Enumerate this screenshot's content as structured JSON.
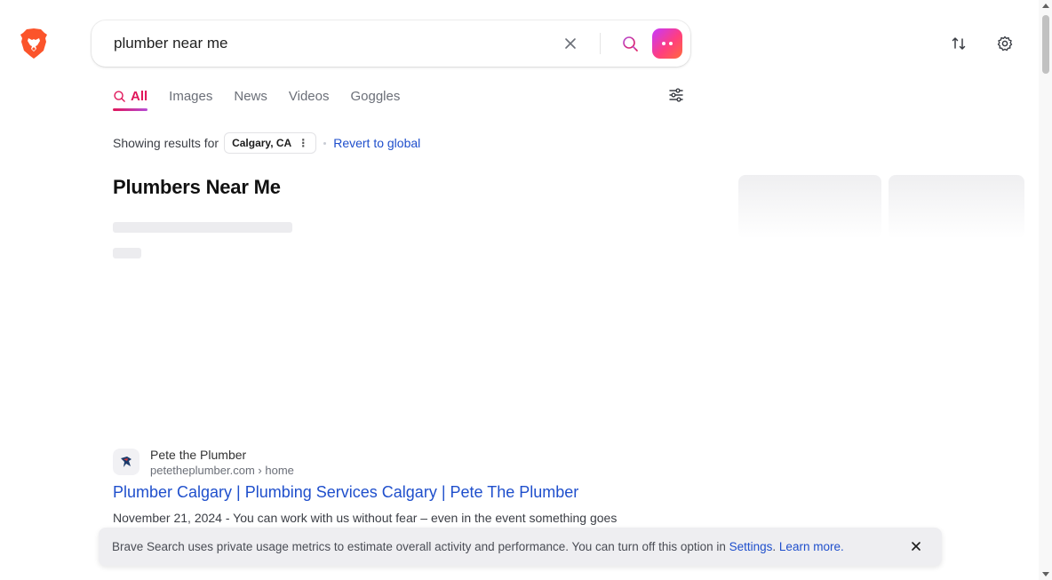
{
  "search": {
    "query": "plumber near me"
  },
  "tabs": [
    {
      "label": "All",
      "active": true
    },
    {
      "label": "Images",
      "active": false
    },
    {
      "label": "News",
      "active": false
    },
    {
      "label": "Videos",
      "active": false
    },
    {
      "label": "Goggles",
      "active": false
    }
  ],
  "location": {
    "prefix": "Showing results for",
    "place": "Calgary, CA",
    "revert_label": "Revert to global"
  },
  "section": {
    "title": "Plumbers Near Me"
  },
  "result": {
    "site_name": "Pete the Plumber",
    "domain": "petetheplumber.com",
    "path": "› home",
    "title": "Plumber Calgary | Plumbing Services Calgary | Pete The Plumber",
    "snippet": "November 21, 2024 - You can work with us without fear – even in the event something goes"
  },
  "notice": {
    "text": "Brave Search uses private usage metrics to estimate overall activity and performance. You can turn off this option in ",
    "settings_link": "Settings",
    "after_link": ". ",
    "learn_more": "Learn more."
  },
  "icons": {
    "logo": "brave-lion-icon",
    "clear": "close-icon",
    "search": "search-icon",
    "assistant": "leo-assistant-icon",
    "sort": "sort-arrows-icon",
    "settings": "gear-icon",
    "filters": "sliders-icon"
  },
  "colors": {
    "accent": "#e0165a",
    "link": "#1f4fcc",
    "brand": "#fb542b"
  }
}
